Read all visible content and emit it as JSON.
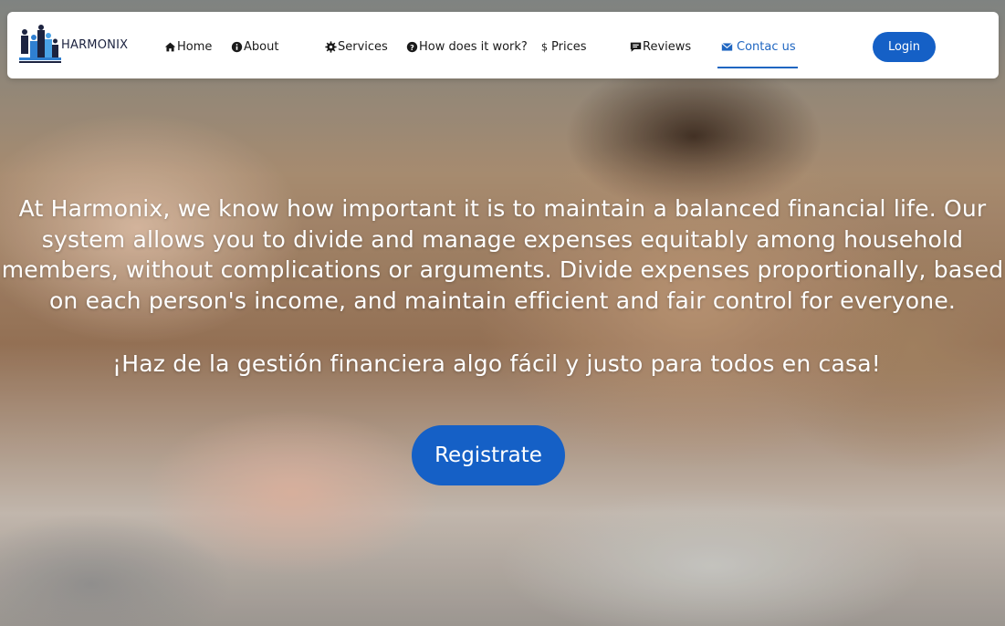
{
  "brand": {
    "name": "HARMONIX",
    "logo_icon": "family-logo-icon"
  },
  "nav": {
    "items": [
      {
        "label": "Home",
        "icon": "home-icon"
      },
      {
        "label": "About",
        "icon": "info-icon"
      },
      {
        "label": "Services",
        "icon": "gear-icon"
      },
      {
        "label": "How does it work?",
        "icon": "question-icon"
      },
      {
        "label": "Prices",
        "icon": "dollar-icon"
      },
      {
        "label": "Reviews",
        "icon": "review-icon"
      },
      {
        "label": "Contac us",
        "icon": "mail-icon",
        "active": true
      }
    ],
    "login_label": "Login"
  },
  "hero": {
    "text": "At Harmonix, we know how important it is to maintain a balanced financial life. Our system allows you to divide and manage expenses equitably among household members, without complications or arguments. Divide expenses proportionally, based on each person's income, and maintain efficient and fair control for everyone.",
    "subtitle": "¡Haz de la gestión financiera algo fácil y justo para todos en casa!",
    "cta_label": "Registrate"
  },
  "colors": {
    "accent": "#1560c6",
    "active_link": "#1f66c1",
    "brand_text": "#1c2340"
  }
}
